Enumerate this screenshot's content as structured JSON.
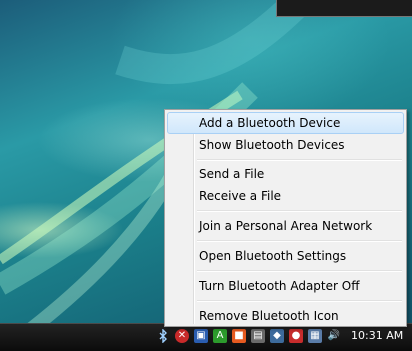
{
  "context_menu": {
    "items": [
      {
        "label": "Add a Bluetooth Device"
      },
      {
        "label": "Show Bluetooth Devices"
      },
      {
        "label": "Send a File"
      },
      {
        "label": "Receive a File"
      },
      {
        "label": "Join a Personal Area Network"
      },
      {
        "label": "Open Bluetooth Settings"
      },
      {
        "label": "Turn Bluetooth Adapter Off"
      },
      {
        "label": "Remove Bluetooth Icon"
      }
    ]
  },
  "taskbar": {
    "clock": "10:31 AM",
    "tray_icons": [
      "bluetooth-icon",
      "shield-icon",
      "app-icon",
      "network-icon",
      "volume-icon"
    ]
  },
  "colors": {
    "menu_background": "#f1f1f1",
    "highlight": "#d0e7fb",
    "taskbar": "#0b0b0b"
  }
}
